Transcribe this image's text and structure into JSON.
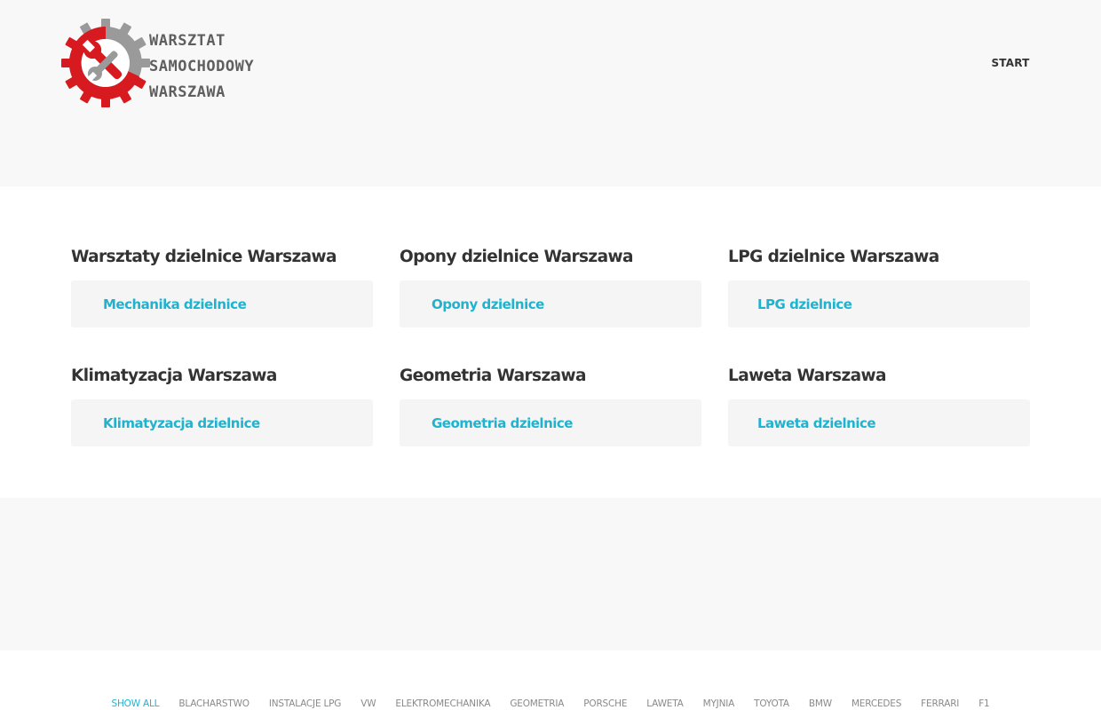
{
  "header": {
    "logo": {
      "lines": [
        "WARSZTAT",
        "SAMOCHODOWY",
        "WARSZAWA"
      ],
      "icon": "gear-wrench-icon",
      "colors": {
        "gear_red": "#d71920",
        "gear_gray": "#9a9a9a",
        "text": "#5f5f5f"
      }
    },
    "nav": {
      "start": "START"
    }
  },
  "sections": [
    {
      "title": "Warsztaty dzielnice Warszawa",
      "link": "Mechanika dzielnice"
    },
    {
      "title": "Opony dzielnice Warszawa",
      "link": "Opony dzielnice"
    },
    {
      "title": "LPG dzielnice Warszawa",
      "link": "LPG dzielnice"
    },
    {
      "title": "Klimatyzacja Warszawa",
      "link": "Klimatyzacja dzielnice"
    },
    {
      "title": "Geometria Warszawa",
      "link": "Geometria dzielnice"
    },
    {
      "title": "Laweta Warszawa",
      "link": "Laweta dzielnice"
    }
  ],
  "filters": [
    "SHOW ALL",
    "BLACHARSTWO",
    "INSTALACJE LPG",
    "VW",
    "ELEKTROMECHANIKA",
    "GEOMETRIA",
    "PORSCHE",
    "LAWETA",
    "MYJNIA",
    "TOYOTA",
    "BMW",
    "MERCEDES",
    "FERRARI",
    "F1"
  ],
  "active_filter": "SHOW ALL",
  "colors": {
    "accent": "#1fb3cf",
    "heading": "#333333",
    "card_bg": "#f5f5f5"
  }
}
